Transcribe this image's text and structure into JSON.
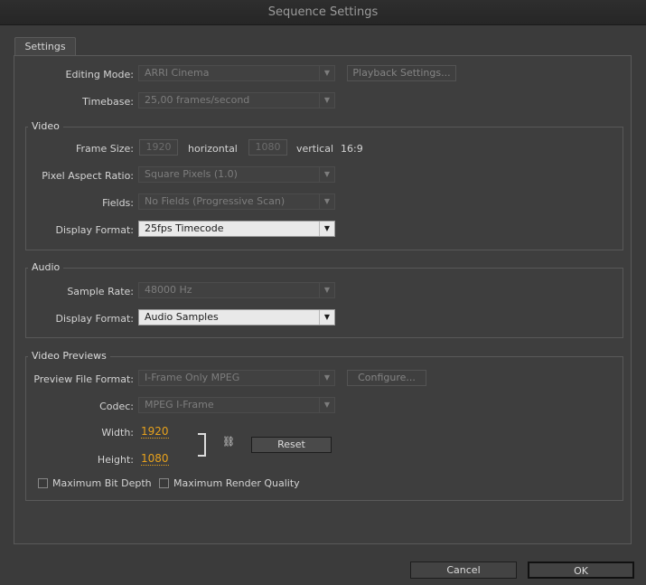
{
  "window": {
    "title": "Sequence Settings"
  },
  "tabs": [
    {
      "label": "Settings"
    }
  ],
  "general": {
    "editing_mode": {
      "label": "Editing Mode:",
      "value": "ARRI Cinema"
    },
    "playback_settings_label": "Playback Settings...",
    "timebase": {
      "label": "Timebase:",
      "value": "25,00 frames/second"
    }
  },
  "video": {
    "title": "Video",
    "frame_size": {
      "label": "Frame Size:",
      "width": "1920",
      "horizontal_label": "horizontal",
      "height": "1080",
      "vertical_label": "vertical",
      "aspect": "16:9"
    },
    "pixel_aspect_ratio": {
      "label": "Pixel Aspect Ratio:",
      "value": "Square Pixels (1.0)"
    },
    "fields": {
      "label": "Fields:",
      "value": "No Fields (Progressive Scan)"
    },
    "display_format": {
      "label": "Display Format:",
      "value": "25fps Timecode"
    }
  },
  "audio": {
    "title": "Audio",
    "sample_rate": {
      "label": "Sample Rate:",
      "value": "48000 Hz"
    },
    "display_format": {
      "label": "Display Format:",
      "value": "Audio Samples"
    }
  },
  "previews": {
    "title": "Video Previews",
    "preview_file_format": {
      "label": "Preview File Format:",
      "value": "I-Frame Only MPEG"
    },
    "configure_label": "Configure...",
    "codec": {
      "label": "Codec:",
      "value": "MPEG I-Frame"
    },
    "width": {
      "label": "Width:",
      "value": "1920"
    },
    "height": {
      "label": "Height:",
      "value": "1080"
    },
    "reset_label": "Reset",
    "max_bit_depth_label": "Maximum Bit Depth",
    "max_render_quality_label": "Maximum Render Quality"
  },
  "footer": {
    "cancel_label": "Cancel",
    "ok_label": "OK"
  },
  "colors": {
    "accent": "#e8a21c",
    "background": "#3b3b3b"
  }
}
